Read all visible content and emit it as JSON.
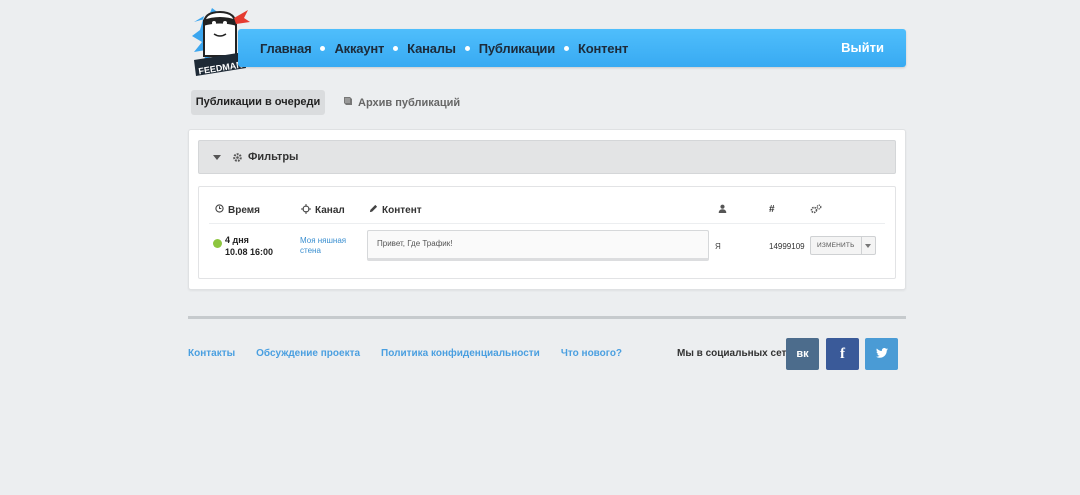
{
  "header": {
    "logo_text": "FEEDMAN",
    "nav": [
      "Главная",
      "Аккаунт",
      "Каналы",
      "Публикации",
      "Контент"
    ],
    "logout": "Выйти",
    "brand_color": "#41b2f6"
  },
  "tabs": {
    "queue": "Публикации в очереди",
    "archive": "Архив публикаций"
  },
  "filters": {
    "label": "Фильтры"
  },
  "table": {
    "headers": {
      "time": "Время",
      "channel": "Канал",
      "content": "Контент",
      "id": "#"
    },
    "row": {
      "time_ago": "4 дня",
      "datetime": "10.08 16:00",
      "channel": "Моя няшная стена",
      "content": "Привет, Где Трафик!",
      "user": "Я",
      "id": "14999109",
      "edit": "ИЗМЕНИТЬ",
      "status_color": "#8dc63f"
    }
  },
  "footer": {
    "links": [
      "Контакты",
      "Обсуждение проекта",
      "Политика конфиденциальности",
      "Что нового?"
    ],
    "social_label": "Мы в социальных сетях:",
    "social": {
      "vk": "вк",
      "fb": "f"
    }
  }
}
